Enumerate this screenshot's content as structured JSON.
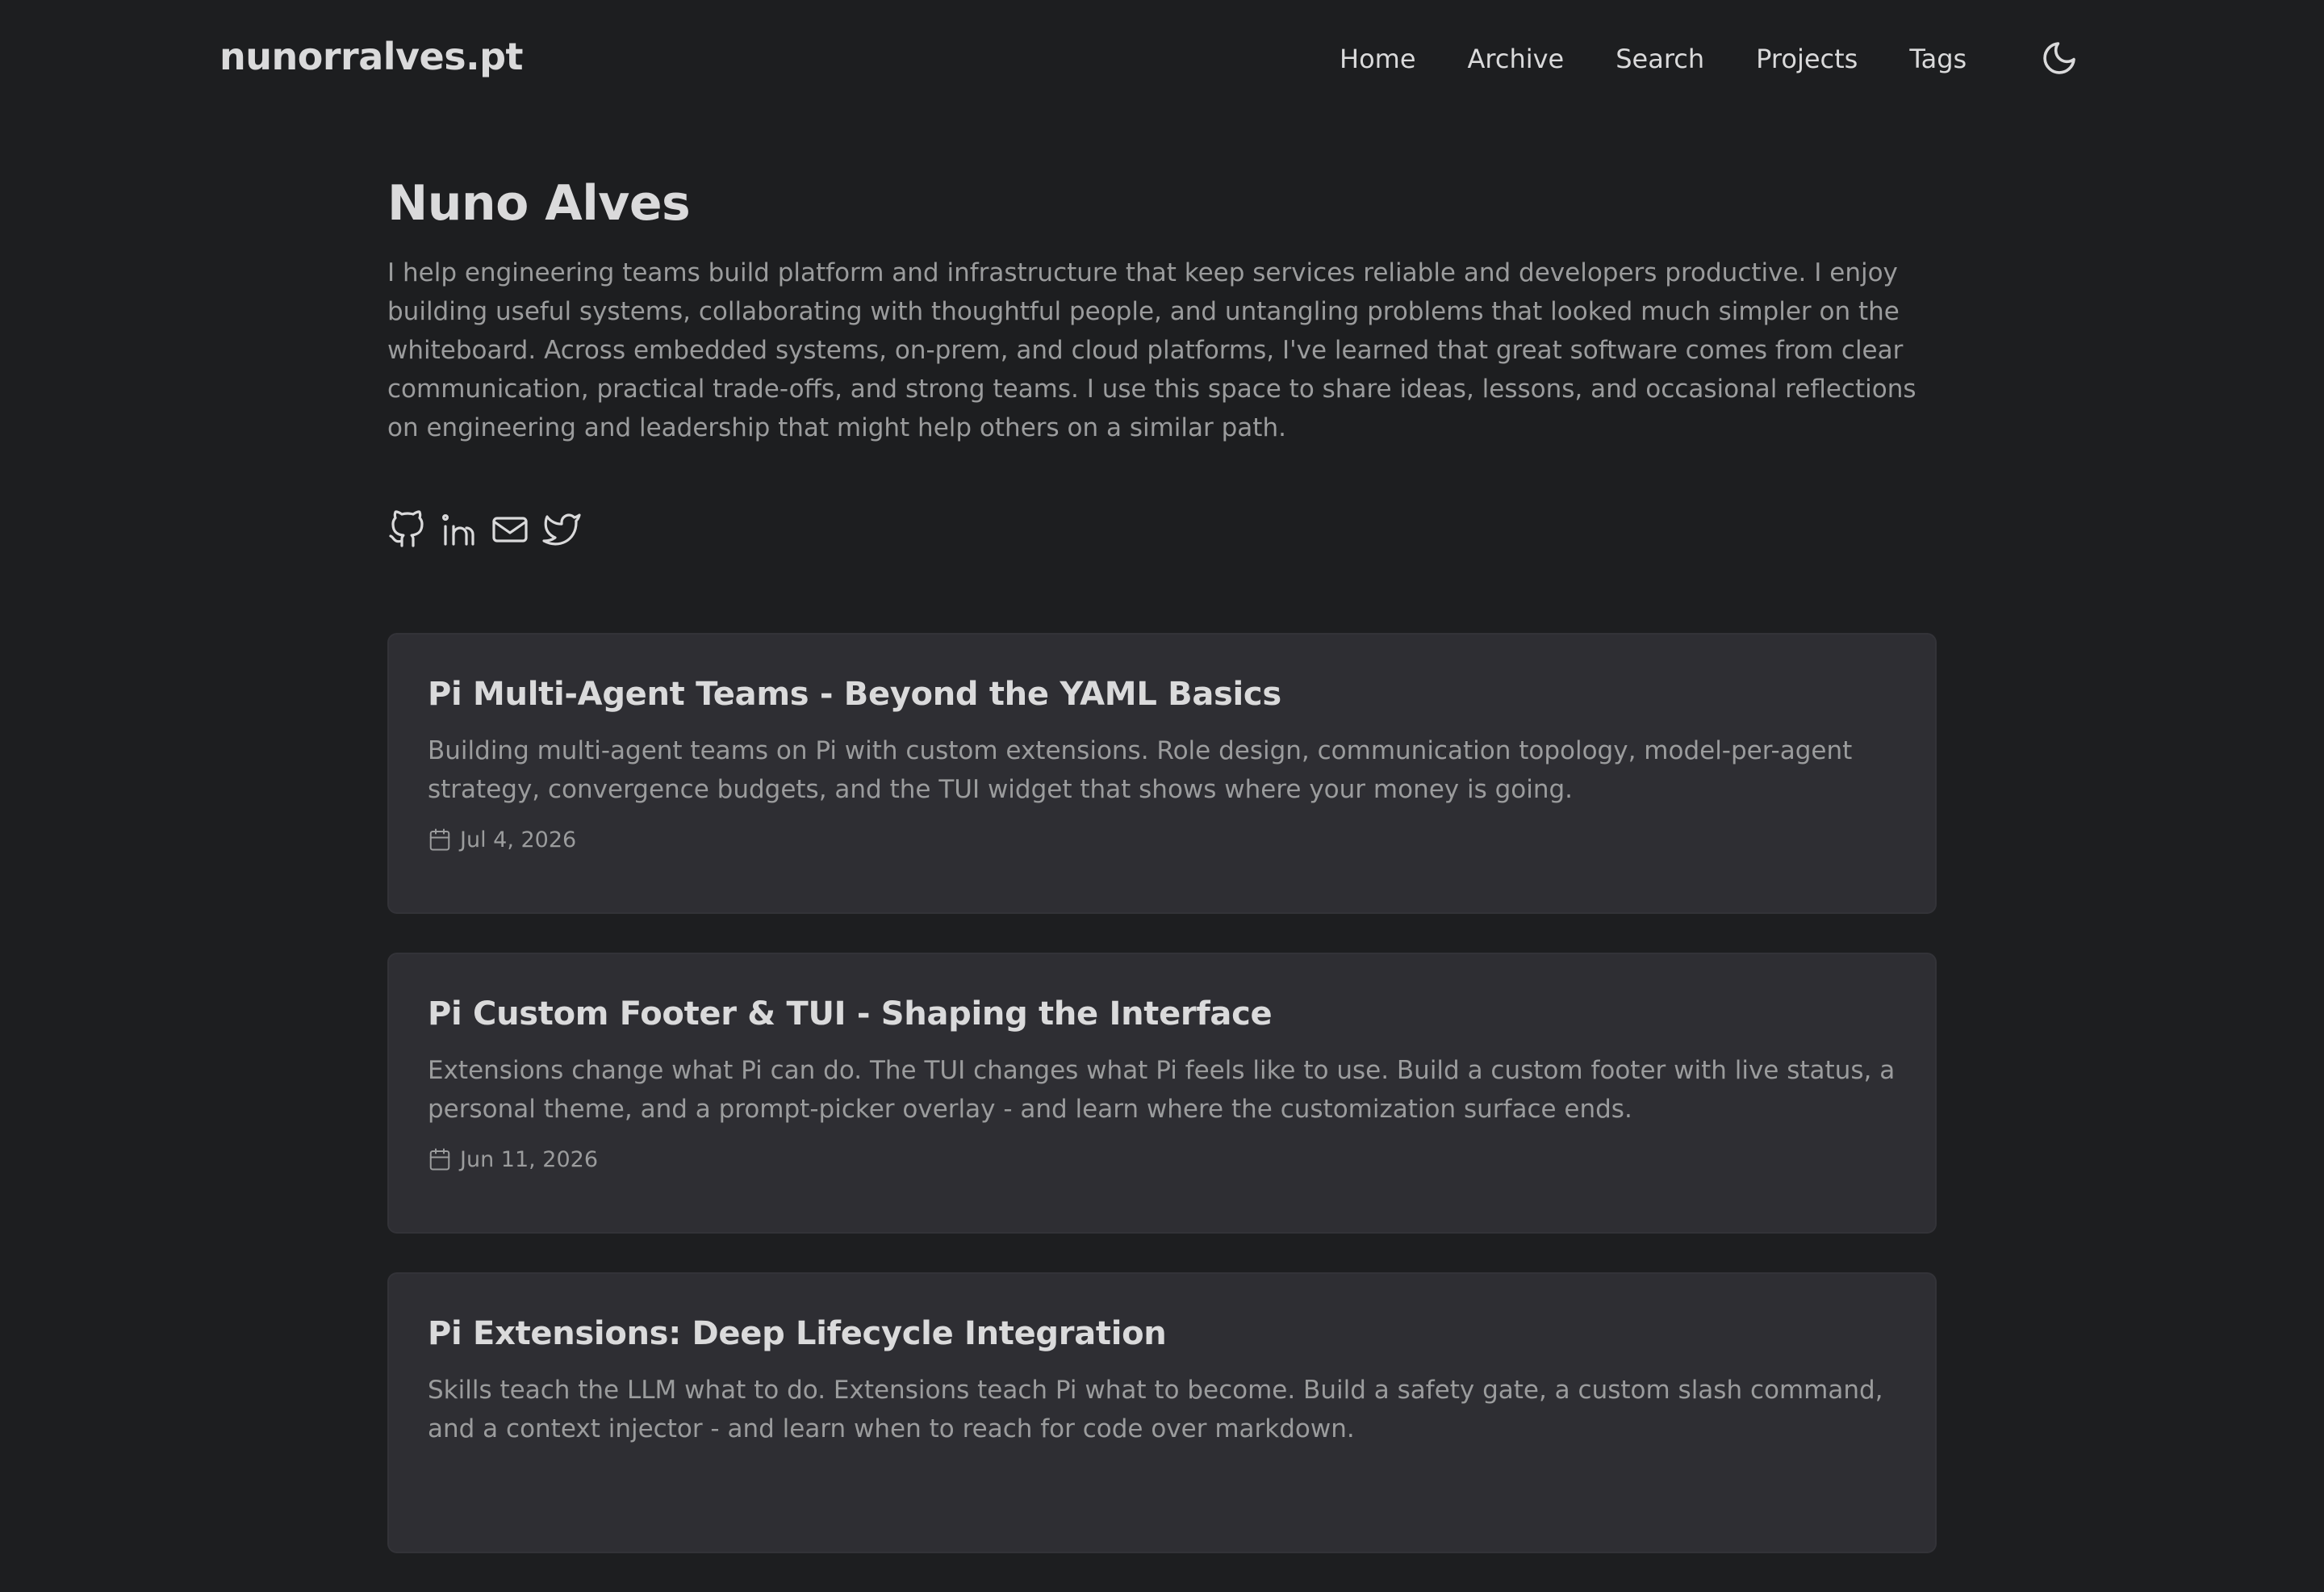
{
  "site": {
    "logo": "nunorralves.pt"
  },
  "nav": {
    "items": [
      "Home",
      "Archive",
      "Search",
      "Projects",
      "Tags"
    ]
  },
  "profile": {
    "name": "Nuno Alves",
    "bio": "I help engineering teams build platform and infrastructure that keep services reliable and developers productive. I enjoy building useful systems, collaborating with thoughtful people, and untangling problems that looked much simpler on the whiteboard. Across embedded systems, on-prem, and cloud platforms, I've learned that great software comes from clear communication, practical trade-offs, and strong teams. I use this space to share ideas, lessons, and occasional reflections on engineering and leadership that might help others on a similar path.",
    "socials": [
      "github-icon",
      "linkedin-icon",
      "mail-icon",
      "twitter-icon"
    ]
  },
  "posts": [
    {
      "title": "Pi Multi-Agent Teams - Beyond the YAML Basics",
      "excerpt": "Building multi-agent teams on Pi with custom extensions. Role design, communication topology, model-per-agent strategy, convergence budgets, and the TUI widget that shows where your money is going.",
      "date": "Jul 4, 2026"
    },
    {
      "title": "Pi Custom Footer & TUI - Shaping the Interface",
      "excerpt": "Extensions change what Pi can do. The TUI changes what Pi feels like to use. Build a custom footer with live status, a personal theme, and a prompt-picker overlay - and learn where the customization surface ends.",
      "date": "Jun 11, 2026"
    },
    {
      "title": "Pi Extensions: Deep Lifecycle Integration",
      "excerpt": "Skills teach the LLM what to do. Extensions teach Pi what to become. Build a safety gate, a custom slash command, and a context injector - and learn when to reach for code over markdown.",
      "date": ""
    }
  ],
  "colors": {
    "background": "#1d1e20",
    "card": "#2e2e33",
    "primary_text": "#dadadb",
    "secondary_text": "#9b9c9d"
  },
  "icons": {
    "theme_toggle": "moon-icon",
    "date": "calendar-icon"
  }
}
